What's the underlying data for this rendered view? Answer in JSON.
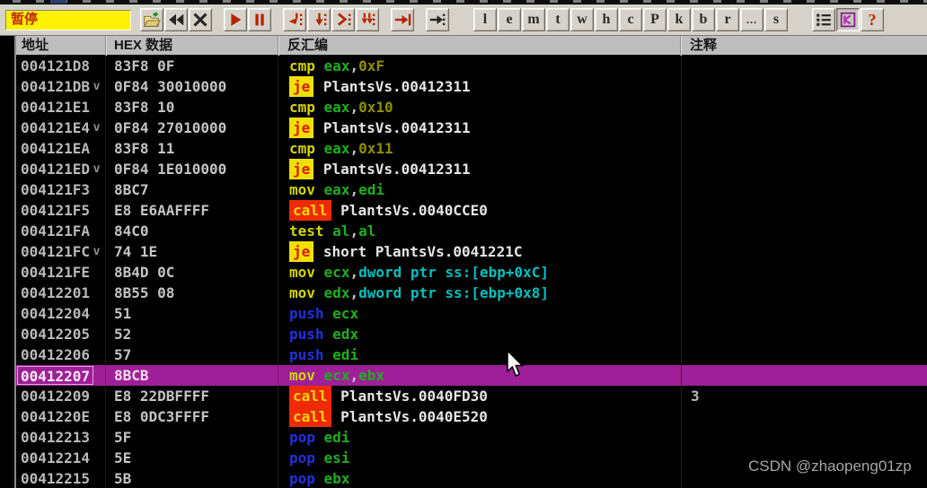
{
  "toolbar": {
    "status_label": "暂停",
    "buttons": [
      {
        "name": "open-folder-icon",
        "gap": 10
      },
      {
        "name": "restart-icon",
        "gap": 1
      },
      {
        "name": "close-window-icon",
        "gap": 1
      },
      {
        "name": "run-icon",
        "gap": 13
      },
      {
        "name": "pause-icon",
        "gap": 1
      },
      {
        "name": "step-into-icon",
        "gap": 13
      },
      {
        "name": "step-over-icon",
        "gap": 1
      },
      {
        "name": "animate-into-icon",
        "gap": 1
      },
      {
        "name": "animate-over-icon",
        "gap": 1
      },
      {
        "name": "execute-till-return-icon",
        "gap": 13
      },
      {
        "name": "goto-address-icon",
        "gap": 13
      },
      {
        "name": "panel-button-log",
        "gap": 27,
        "label": "l"
      },
      {
        "name": "panel-button-executables",
        "gap": 1,
        "label": "e"
      },
      {
        "name": "panel-button-memory",
        "gap": 1,
        "label": "m"
      },
      {
        "name": "panel-button-threads",
        "gap": 1,
        "label": "t"
      },
      {
        "name": "panel-button-windows",
        "gap": 1,
        "label": "w"
      },
      {
        "name": "panel-button-handles",
        "gap": 1,
        "label": "h"
      },
      {
        "name": "panel-button-cpu",
        "gap": 1,
        "label": "c"
      },
      {
        "name": "panel-button-patches",
        "gap": 1,
        "label": "P"
      },
      {
        "name": "panel-button-callstack",
        "gap": 1,
        "label": "k"
      },
      {
        "name": "panel-button-breakpoints",
        "gap": 1,
        "label": "b"
      },
      {
        "name": "panel-button-references",
        "gap": 1,
        "label": "r"
      },
      {
        "name": "panel-button-runtrace",
        "gap": 1,
        "label": "...",
        "style": "dots"
      },
      {
        "name": "panel-button-source",
        "gap": 1,
        "label": "s"
      },
      {
        "name": "windows-list-icon",
        "gap": 27
      },
      {
        "name": "cpu-window-icon",
        "gap": 1,
        "pressed": true
      },
      {
        "name": "help-icon",
        "gap": 1,
        "label": "?",
        "style": "help"
      }
    ]
  },
  "table": {
    "columns": [
      "地址",
      "HEX 数据",
      "反汇编",
      "注释"
    ],
    "rows": [
      {
        "address": "004121D8",
        "jump": "",
        "hex": "83F8 0F",
        "tokens": [
          [
            "mn",
            "cmp"
          ],
          [
            "sep",
            " "
          ],
          [
            "reg",
            "eax"
          ],
          [
            "sep",
            ","
          ],
          [
            "imm",
            "0xF"
          ]
        ],
        "comment": ""
      },
      {
        "address": "004121DB",
        "jump": "v",
        "hex": "0F84 30010000",
        "tokens": [
          [
            "jmp",
            "je"
          ],
          [
            "sep",
            " "
          ],
          [
            "sym",
            "PlantsVs.00412311"
          ]
        ],
        "comment": ""
      },
      {
        "address": "004121E1",
        "jump": "",
        "hex": "83F8 10",
        "tokens": [
          [
            "mn",
            "cmp"
          ],
          [
            "sep",
            " "
          ],
          [
            "reg",
            "eax"
          ],
          [
            "sep",
            ","
          ],
          [
            "imm",
            "0x10"
          ]
        ],
        "comment": ""
      },
      {
        "address": "004121E4",
        "jump": "v",
        "hex": "0F84 27010000",
        "tokens": [
          [
            "jmp",
            "je"
          ],
          [
            "sep",
            " "
          ],
          [
            "sym",
            "PlantsVs.00412311"
          ]
        ],
        "comment": ""
      },
      {
        "address": "004121EA",
        "jump": "",
        "hex": "83F8 11",
        "tokens": [
          [
            "mn",
            "cmp"
          ],
          [
            "sep",
            " "
          ],
          [
            "reg",
            "eax"
          ],
          [
            "sep",
            ","
          ],
          [
            "imm",
            "0x11"
          ]
        ],
        "comment": ""
      },
      {
        "address": "004121ED",
        "jump": "v",
        "hex": "0F84 1E010000",
        "tokens": [
          [
            "jmp",
            "je"
          ],
          [
            "sep",
            " "
          ],
          [
            "sym",
            "PlantsVs.00412311"
          ]
        ],
        "comment": ""
      },
      {
        "address": "004121F3",
        "jump": "",
        "hex": "8BC7",
        "tokens": [
          [
            "mn",
            "mov"
          ],
          [
            "sep",
            " "
          ],
          [
            "reg",
            "eax"
          ],
          [
            "sep",
            ","
          ],
          [
            "reg",
            "edi"
          ]
        ],
        "comment": ""
      },
      {
        "address": "004121F5",
        "jump": "",
        "hex": "E8 E6AAFFFF",
        "tokens": [
          [
            "call",
            "call"
          ],
          [
            "sep",
            " "
          ],
          [
            "sym",
            "PlantsVs.0040CCE0"
          ]
        ],
        "comment": ""
      },
      {
        "address": "004121FA",
        "jump": "",
        "hex": "84C0",
        "tokens": [
          [
            "mn",
            "test"
          ],
          [
            "sep",
            " "
          ],
          [
            "reg",
            "al"
          ],
          [
            "sep",
            ","
          ],
          [
            "reg",
            "al"
          ]
        ],
        "comment": ""
      },
      {
        "address": "004121FC",
        "jump": "v",
        "hex": "74 1E",
        "tokens": [
          [
            "jmp",
            "je"
          ],
          [
            "sep",
            " "
          ],
          [
            "sym",
            "short PlantsVs.0041221C"
          ]
        ],
        "comment": ""
      },
      {
        "address": "004121FE",
        "jump": "",
        "hex": "8B4D 0C",
        "tokens": [
          [
            "mn",
            "mov"
          ],
          [
            "sep",
            " "
          ],
          [
            "reg",
            "ecx"
          ],
          [
            "sep",
            ","
          ],
          [
            "mem",
            "dword ptr ss:[ebp+0xC]"
          ]
        ],
        "comment": ""
      },
      {
        "address": "00412201",
        "jump": "",
        "hex": "8B55 08",
        "tokens": [
          [
            "mn",
            "mov"
          ],
          [
            "sep",
            " "
          ],
          [
            "reg",
            "edx"
          ],
          [
            "sep",
            ","
          ],
          [
            "mem",
            "dword ptr ss:[ebp+0x8]"
          ]
        ],
        "comment": ""
      },
      {
        "address": "00412204",
        "jump": "",
        "hex": "51",
        "tokens": [
          [
            "stk",
            "push"
          ],
          [
            "sep",
            " "
          ],
          [
            "reg",
            "ecx"
          ]
        ],
        "comment": ""
      },
      {
        "address": "00412205",
        "jump": "",
        "hex": "52",
        "tokens": [
          [
            "stk",
            "push"
          ],
          [
            "sep",
            " "
          ],
          [
            "reg",
            "edx"
          ]
        ],
        "comment": ""
      },
      {
        "address": "00412206",
        "jump": "",
        "hex": "57",
        "tokens": [
          [
            "stk",
            "push"
          ],
          [
            "sep",
            " "
          ],
          [
            "reg",
            "edi"
          ]
        ],
        "comment": ""
      },
      {
        "address": "00412207",
        "jump": "",
        "hex": "8BCB",
        "tokens": [
          [
            "mn",
            "mov"
          ],
          [
            "sep",
            " "
          ],
          [
            "reg",
            "ecx"
          ],
          [
            "sep",
            ","
          ],
          [
            "reg",
            "ebx"
          ]
        ],
        "comment": "",
        "selected": true
      },
      {
        "address": "00412209",
        "jump": "",
        "hex": "E8 22DBFFFF",
        "tokens": [
          [
            "call",
            "call"
          ],
          [
            "sep",
            " "
          ],
          [
            "sym",
            "PlantsVs.0040FD30"
          ]
        ],
        "comment": "3"
      },
      {
        "address": "0041220E",
        "jump": "",
        "hex": "E8 0DC3FFFF",
        "tokens": [
          [
            "call",
            "call"
          ],
          [
            "sep",
            " "
          ],
          [
            "sym",
            "PlantsVs.0040E520"
          ]
        ],
        "comment": ""
      },
      {
        "address": "00412213",
        "jump": "",
        "hex": "5F",
        "tokens": [
          [
            "stk",
            "pop"
          ],
          [
            "sep",
            " "
          ],
          [
            "reg",
            "edi"
          ]
        ],
        "comment": ""
      },
      {
        "address": "00412214",
        "jump": "",
        "hex": "5E",
        "tokens": [
          [
            "stk",
            "pop"
          ],
          [
            "sep",
            " "
          ],
          [
            "reg",
            "esi"
          ]
        ],
        "comment": ""
      },
      {
        "address": "00412215",
        "jump": "",
        "hex": "5B",
        "tokens": [
          [
            "stk",
            "pop"
          ],
          [
            "sep",
            " "
          ],
          [
            "reg",
            "ebx"
          ]
        ],
        "comment": ""
      }
    ]
  },
  "watermark": "CSDN @zhaopeng01zp",
  "colors": {
    "selection_bg": "#9E1F97",
    "jump_box_bg": "#EFE000",
    "jump_box_text": "#DC1800",
    "call_box_bg": "#EE2A00",
    "call_box_text": "#FFD800",
    "mnemonic": "#D4D400",
    "register": "#1FAE1F",
    "immediate": "#8F8F00",
    "memory_operand": "#00BFBF",
    "push_pop": "#2230DC",
    "status_bg": "#FFF200",
    "status_text": "#C22A08",
    "toolbar_bg": "#D6D2CA",
    "header_bg": "#BDBDBD"
  }
}
